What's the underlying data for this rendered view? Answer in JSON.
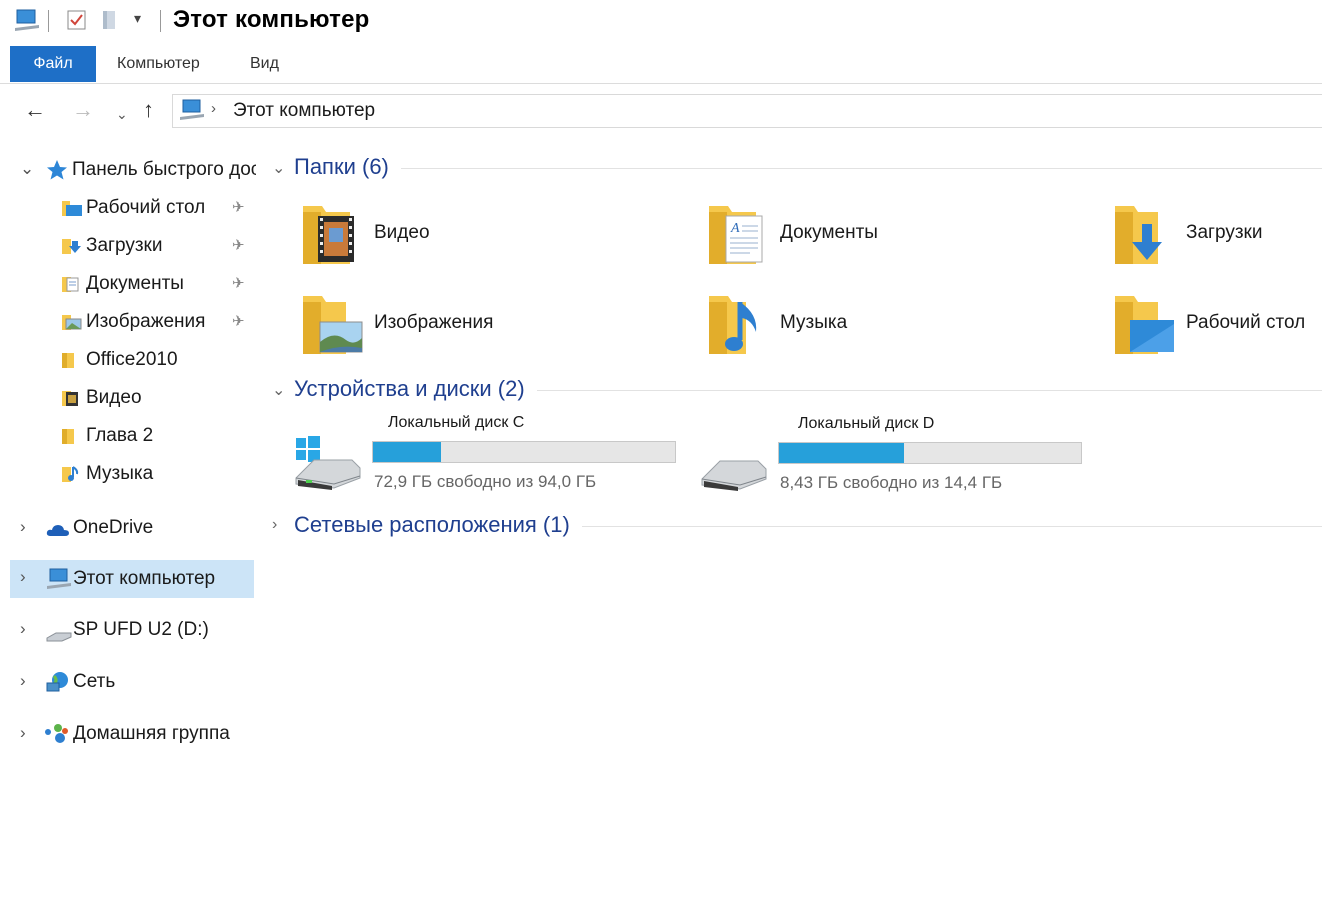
{
  "window": {
    "title": "Этот компьютер",
    "qa_icons": [
      "computer-icon",
      "properties-icon",
      "new-folder-icon",
      "customize-arrow-icon"
    ]
  },
  "ribbon": {
    "tabs": [
      {
        "label": "Файл",
        "active": true
      },
      {
        "label": "Компьютер",
        "active": false
      },
      {
        "label": "Вид",
        "active": false
      }
    ]
  },
  "address": {
    "path": "Этот компьютер"
  },
  "sidebar": {
    "quick_access": "Панель быстрого доступа",
    "quick_items": [
      {
        "label": "Рабочий стол",
        "pinned": true,
        "icon": "desktop-folder-icon"
      },
      {
        "label": "Загрузки",
        "pinned": true,
        "icon": "downloads-folder-icon"
      },
      {
        "label": "Документы",
        "pinned": true,
        "icon": "documents-folder-icon"
      },
      {
        "label": "Изображения",
        "pinned": true,
        "icon": "pictures-folder-icon"
      },
      {
        "label": "Office2010",
        "pinned": false,
        "icon": "folder-icon"
      },
      {
        "label": "Видео",
        "pinned": false,
        "icon": "videos-folder-icon"
      },
      {
        "label": "Глава 2",
        "pinned": false,
        "icon": "folder-icon"
      },
      {
        "label": "Музыка",
        "pinned": false,
        "icon": "music-folder-icon"
      }
    ],
    "roots": [
      {
        "label": "OneDrive",
        "icon": "onedrive-icon",
        "selected": false
      },
      {
        "label": "Этот компьютер",
        "icon": "computer-icon",
        "selected": true
      },
      {
        "label": "SP UFD U2 (D:)",
        "icon": "usb-drive-icon",
        "selected": false
      },
      {
        "label": "Сеть",
        "icon": "network-icon",
        "selected": false
      },
      {
        "label": "Домашняя группа",
        "icon": "homegroup-icon",
        "selected": false
      }
    ]
  },
  "main": {
    "folders_header": "Папки (6)",
    "folders": [
      {
        "name": "Видео",
        "icon": "videos-folder-icon"
      },
      {
        "name": "Документы",
        "icon": "documents-folder-icon"
      },
      {
        "name": "Загрузки",
        "icon": "downloads-folder-icon"
      },
      {
        "name": "Изображения",
        "icon": "pictures-folder-icon"
      },
      {
        "name": "Музыка",
        "icon": "music-folder-icon"
      },
      {
        "name": "Рабочий стол",
        "icon": "desktop-folder-icon"
      }
    ],
    "devices_header": "Устройства и диски (2)",
    "drives": [
      {
        "name": "Локальный диск C",
        "free_text": "72,9 ГБ свободно из 94,0 ГБ",
        "used_fraction": 0.224,
        "icon": "system-drive-icon"
      },
      {
        "name": "Локальный диск D",
        "free_text": "8,43 ГБ свободно из 14,4 ГБ",
        "used_fraction": 0.415,
        "icon": "hard-drive-icon"
      }
    ],
    "network_header": "Сетевые расположения (1)"
  },
  "colors": {
    "accent": "#1e6fc7",
    "section_title": "#1f3f8f",
    "drive_bar": "#26a0da",
    "selected_bg": "#cce4f7",
    "folder_yellow": "#f5c84c"
  }
}
